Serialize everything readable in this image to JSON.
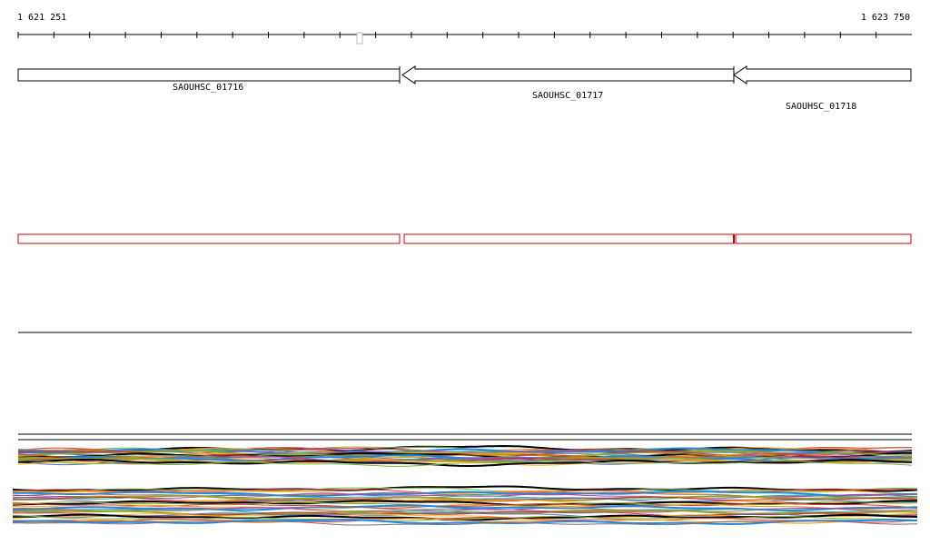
{
  "ruler": {
    "start_label": "1 621 251",
    "end_label": "1 623 750"
  },
  "genes": [
    {
      "name": "SAOUHSC_01716",
      "strand": "+"
    },
    {
      "name": "SAOUHSC_01717",
      "strand": "-"
    },
    {
      "name": "SAOUHSC_01718",
      "strand": "-"
    }
  ],
  "colors": {
    "gene_outline": "#000000",
    "region_outline": "#d00000",
    "track_line": "#000000"
  },
  "expression_track_colors": [
    "#000000",
    "#7cb342",
    "#e53935",
    "#ff9800",
    "#1e88e5",
    "#8d6e63",
    "#ab47bc",
    "#26a69a",
    "#9e9d24",
    "#c62828",
    "#5c6bc0",
    "#ffb300"
  ]
}
